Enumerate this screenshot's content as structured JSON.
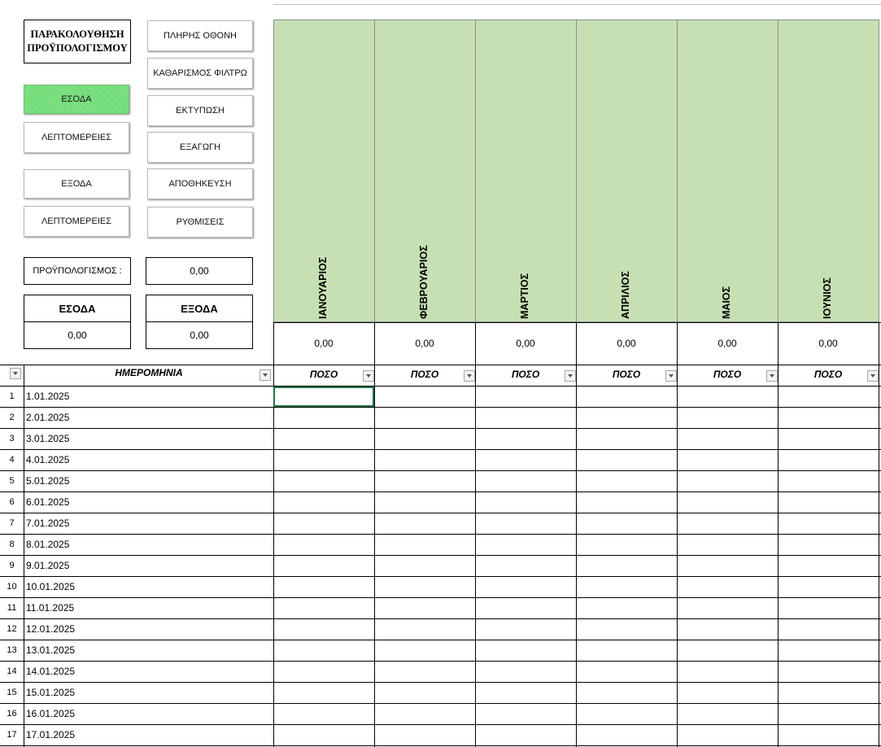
{
  "panel": {
    "title_line1": "ΠΑΡΑΚΟΛΟΥΘΗΣΗ",
    "title_line2": "ΠΡΟΫΠΟΛΟΓΙΣΜΟΥ",
    "buttons_left": [
      "ΕΣΟΔΑ",
      "ΛΕΠΤΟΜΕΡΕΙΕΣ",
      "ΕΞΟΔΑ",
      "ΛΕΠΤΟΜΕΡΕΙΕΣ"
    ],
    "buttons_right": [
      "ΠΛΗΡΗΣ ΟΘΟΝΗ",
      "ΚΑΘΑΡΙΣΜΟΣ ΦΙΛΤΡΩ",
      "ΕΚΤΥΠΩΣΗ",
      "ΕΞΑΓΩΓΗ",
      "ΑΠΟΘΗΚΕΥΣΗ",
      "ΡΥΘΜΙΣΕΙΣ"
    ],
    "budget_label": "ΠΡΟΫΠΟΛΟΓΙΣΜΟΣ :",
    "budget_value": "0,00",
    "income_label": "ΕΣΟΔΑ",
    "income_value": "0,00",
    "expense_label": "ΕΞΟΔΑ",
    "expense_value": "0,00",
    "selected_button": "ΕΣΟΔΑ",
    "selected_color": "#6ddc70"
  },
  "months": [
    {
      "name": "ΙΑΝΟΥΑΡΙΟΣ",
      "total": "0,00"
    },
    {
      "name": "ΦΕΒΡΟΥΑΡΙΟΣ",
      "total": "0,00"
    },
    {
      "name": "ΜΑΡΤΙΟΣ",
      "total": "0,00"
    },
    {
      "name": "ΑΠΡΙΛΙΟΣ",
      "total": "0,00"
    },
    {
      "name": "ΜΑΙΟΣ",
      "total": "0,00"
    },
    {
      "name": "ΙΟΥΝΙΟΣ",
      "total": "0,00"
    }
  ],
  "month_header_color": "#c6e0b4",
  "table": {
    "date_header": "ΗΜΕΡΟΜΗΝΙΑ",
    "amount_header": "ΠΟΣΟ",
    "rows": [
      {
        "n": "1",
        "date": "1.01.2025"
      },
      {
        "n": "2",
        "date": "2.01.2025"
      },
      {
        "n": "3",
        "date": "3.01.2025"
      },
      {
        "n": "4",
        "date": "4.01.2025"
      },
      {
        "n": "5",
        "date": "5.01.2025"
      },
      {
        "n": "6",
        "date": "6.01.2025"
      },
      {
        "n": "7",
        "date": "7.01.2025"
      },
      {
        "n": "8",
        "date": "8.01.2025"
      },
      {
        "n": "9",
        "date": "9.01.2025"
      },
      {
        "n": "10",
        "date": "10.01.2025"
      },
      {
        "n": "11",
        "date": "11.01.2025"
      },
      {
        "n": "12",
        "date": "12.01.2025"
      },
      {
        "n": "13",
        "date": "13.01.2025"
      },
      {
        "n": "14",
        "date": "14.01.2025"
      },
      {
        "n": "15",
        "date": "15.01.2025"
      },
      {
        "n": "16",
        "date": "16.01.2025"
      },
      {
        "n": "17",
        "date": "17.01.2025"
      }
    ],
    "active_cell": "ΙΑΝΟΥΑΡΙΟΣ / 1.01.2025",
    "active_cell_color": "#217346"
  }
}
